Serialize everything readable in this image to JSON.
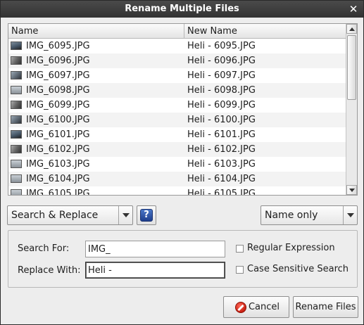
{
  "window": {
    "title": "Rename Multiple Files",
    "close_glyph": "✕"
  },
  "list": {
    "columns": [
      "Name",
      "New Name"
    ],
    "rows": [
      {
        "name": "IMG_6095.JPG",
        "new_name": "Heli - 6095.JPG",
        "icon": "image-thumbnail-icon"
      },
      {
        "name": "IMG_6096.JPG",
        "new_name": "Heli - 6096.JPG",
        "icon": "image-thumbnail-icon"
      },
      {
        "name": "IMG_6097.JPG",
        "new_name": "Heli - 6097.JPG",
        "icon": "image-thumbnail-icon"
      },
      {
        "name": "IMG_6098.JPG",
        "new_name": "Heli - 6098.JPG",
        "icon": "image-thumbnail-icon"
      },
      {
        "name": "IMG_6099.JPG",
        "new_name": "Heli - 6099.JPG",
        "icon": "image-thumbnail-icon"
      },
      {
        "name": "IMG_6100.JPG",
        "new_name": "Heli - 6100.JPG",
        "icon": "image-thumbnail-icon"
      },
      {
        "name": "IMG_6101.JPG",
        "new_name": "Heli - 6101.JPG",
        "icon": "image-thumbnail-icon"
      },
      {
        "name": "IMG_6102.JPG",
        "new_name": "Heli - 6102.JPG",
        "icon": "image-thumbnail-icon"
      },
      {
        "name": "IMG_6103.JPG",
        "new_name": "Heli - 6103.JPG",
        "icon": "image-thumbnail-icon"
      },
      {
        "name": "IMG_6104.JPG",
        "new_name": "Heli - 6104.JPG",
        "icon": "image-thumbnail-icon"
      },
      {
        "name": "IMG_6105.JPG",
        "new_name": "Heli - 6105.JPG",
        "icon": "image-thumbnail-icon"
      }
    ]
  },
  "options": {
    "mode_selected": "Search & Replace",
    "help_glyph": "?",
    "scope_selected": "Name only"
  },
  "search": {
    "search_for_label": "Search For:",
    "search_for_value": "IMG_",
    "replace_with_label": "Replace With:",
    "replace_with_value": "Heli -",
    "regex_label": "Regular Expression",
    "regex_checked": false,
    "case_label": "Case Sensitive Search",
    "case_checked": false
  },
  "buttons": {
    "cancel": "Cancel",
    "rename": "Rename Files"
  }
}
